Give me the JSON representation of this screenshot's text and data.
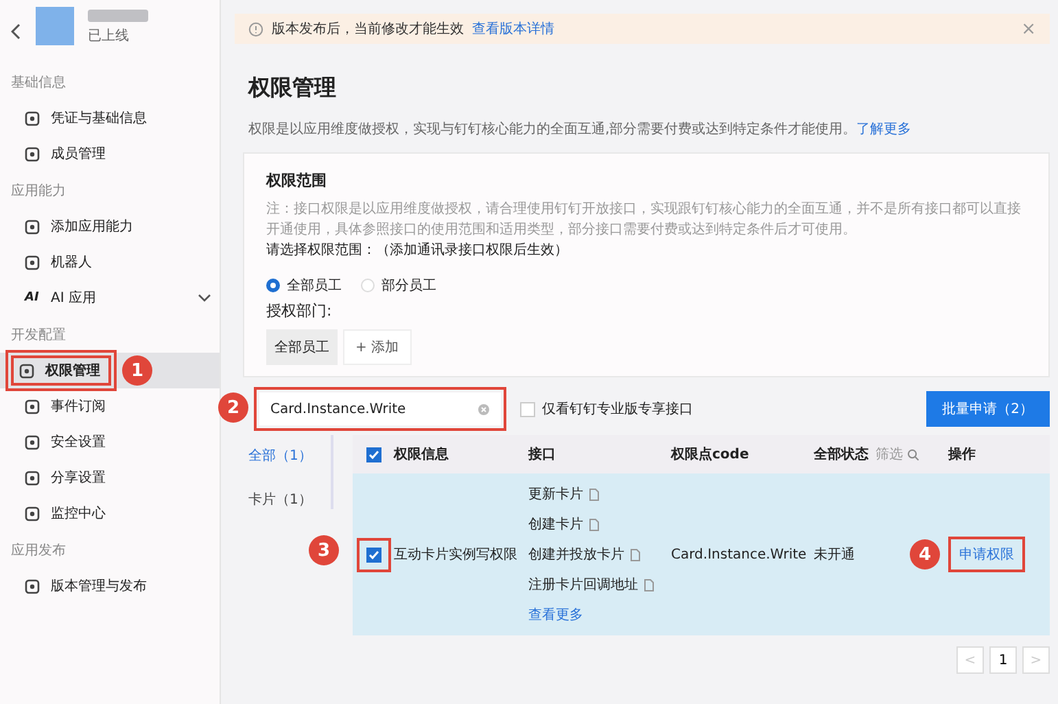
{
  "app": {
    "status": "已上线"
  },
  "sidebar": [
    {
      "kind": "section",
      "label": "基础信息"
    },
    {
      "kind": "item",
      "label": "凭证与基础信息",
      "selected": false
    },
    {
      "kind": "item",
      "label": "成员管理",
      "selected": false
    },
    {
      "kind": "section",
      "label": "应用能力"
    },
    {
      "kind": "item",
      "label": "添加应用能力",
      "selected": false
    },
    {
      "kind": "item",
      "label": "机器人",
      "selected": false
    },
    {
      "kind": "item",
      "label": "AI 应用",
      "icon_text": "AI",
      "expanded": false,
      "selected": false
    },
    {
      "kind": "section",
      "label": "开发配置"
    },
    {
      "kind": "item",
      "label": "权限管理",
      "selected": true,
      "callout": "1"
    },
    {
      "kind": "item",
      "label": "事件订阅",
      "selected": false
    },
    {
      "kind": "item",
      "label": "安全设置",
      "selected": false
    },
    {
      "kind": "item",
      "label": "分享设置",
      "selected": false
    },
    {
      "kind": "item",
      "label": "监控中心",
      "selected": false
    },
    {
      "kind": "section",
      "label": "应用发布"
    },
    {
      "kind": "item",
      "label": "版本管理与发布",
      "selected": false
    }
  ],
  "banner": {
    "text": "版本发布后，当前修改才能生效",
    "link": "查看版本详情",
    "close": "×"
  },
  "title": "权限管理",
  "description": {
    "text": "权限是以应用维度做授权，实现与钉钉核心能力的全面互通,部分需要付费或达到特定条件才能使用。",
    "link": "了解更多"
  },
  "scope": {
    "title": "权限范围",
    "note": "注：接口权限是以应用维度做授权，请合理使用钉钉开放接口，实现跟钉钉核心能力的全面互通，并不是所有接口都可以直接开通使用，具体参照接口的使用范围和适用类型，部分接口需要付费或达到特定条件后才可使用。",
    "prompt": "请选择权限范围：（添加通讯录接口权限后生效）",
    "options": [
      {
        "label": "全部员工",
        "selected": true
      },
      {
        "label": "部分员工",
        "selected": false
      }
    ],
    "dept_label": "授权部门:",
    "dept_tag": "全部员工",
    "add_button": "+ 添加"
  },
  "search": {
    "value": "Card.Instance.Write",
    "callout": "2"
  },
  "pro_only": {
    "label": "仅看钉钉专业版专享接口",
    "checked": false
  },
  "batch_button": "批量申请（2）",
  "categories": [
    {
      "label": "全部（1）",
      "selected": true
    },
    {
      "label": "卡片（1）",
      "selected": false
    }
  ],
  "table": {
    "header_checked": true,
    "columns": [
      "权限信息",
      "接口",
      "权限点code",
      "全部状态",
      "操作"
    ],
    "filter": "筛选",
    "rows": [
      {
        "checked": true,
        "callout": "3",
        "name": "互动卡片实例写权限",
        "apis": [
          "更新卡片",
          "创建卡片",
          "创建并投放卡片",
          "注册卡片回调地址"
        ],
        "more": "查看更多",
        "code": "Card.Instance.Write",
        "status": "未开通",
        "action": "申请权限",
        "action_callout": "4"
      }
    ]
  },
  "pagination": {
    "prev": "<",
    "page": "1",
    "next": ">"
  }
}
